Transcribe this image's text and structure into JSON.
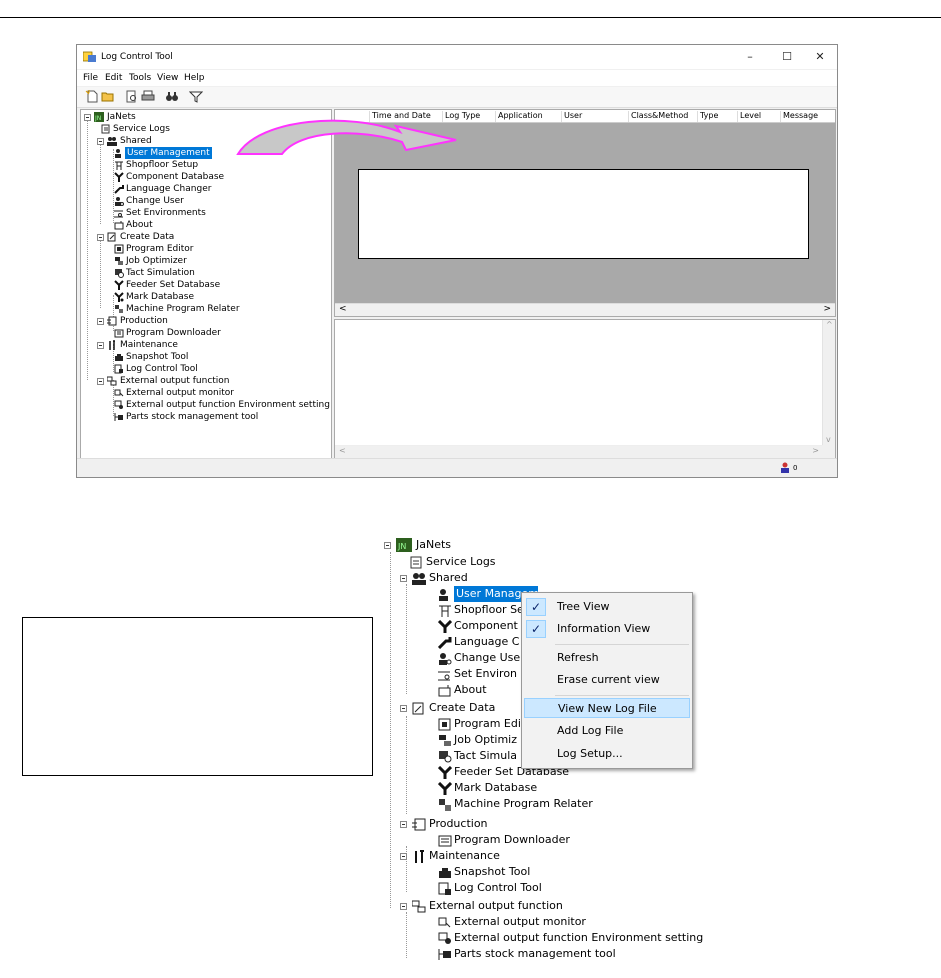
{
  "window": {
    "title": "Log Control Tool",
    "minimize_glyph": "–",
    "maximize_glyph": "☐",
    "close_glyph": "✕"
  },
  "menu": [
    "File",
    "Edit",
    "Tools",
    "View",
    "Help"
  ],
  "columns": [
    "Time and Date",
    "Log Type",
    "Application",
    "User",
    "Class&Method",
    "Type",
    "Level",
    "Message"
  ],
  "status": {
    "user_count": "0"
  },
  "scroll": {
    "left": "<",
    "right": ">",
    "up": "^",
    "down": "v"
  },
  "tree": {
    "root": "JaNets",
    "service_logs": "Service Logs",
    "shared": "Shared",
    "shared_items": [
      "User Management",
      "Shopfloor Setup",
      "Component Database",
      "Language Changer",
      "Change User",
      "Set Environments",
      "About"
    ],
    "create_data": "Create Data",
    "create_items": [
      "Program Editor",
      "Job Optimizer",
      "Tact Simulation",
      "Feeder Set Database",
      "Mark Database",
      "Machine Program Relater"
    ],
    "production": "Production",
    "production_items": [
      "Program Downloader"
    ],
    "maintenance": "Maintenance",
    "maintenance_items": [
      "Snapshot Tool",
      "Log Control Tool"
    ],
    "external": "External output function",
    "external_items": [
      "External output monitor",
      "External output function  Environment setting",
      "Parts stock management tool"
    ]
  },
  "tree2": {
    "shared_items": [
      "User Management",
      "Shopfloor Se",
      "Component",
      "Language C",
      "Change Use",
      "Set Environ",
      "About"
    ],
    "create_items": [
      "Program Edi",
      "Job Optimiz",
      "Tact Simula",
      "Feeder Set Database",
      "Mark Database",
      "Machine Program Relater"
    ]
  },
  "context_menu": {
    "check_glyph": "✓",
    "items": [
      "Tree View",
      "Information View",
      "Refresh",
      "Erase current view",
      "View New Log File",
      "Add Log File",
      "Log Setup..."
    ]
  },
  "colors": {
    "selection": "#0078d7",
    "arrow": "#ff33ff",
    "menu_highlight": "#cce8ff"
  }
}
